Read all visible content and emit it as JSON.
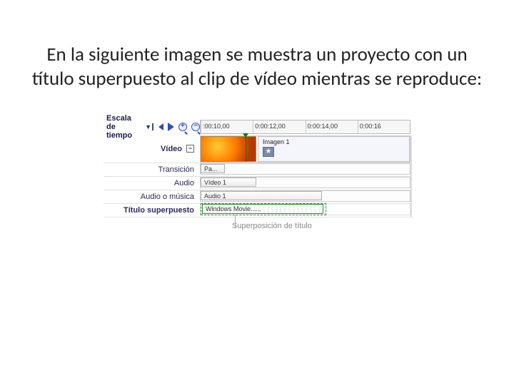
{
  "description_text": "En la siguiente imagen se muestra un proyecto con un título superpuesto al clip de vídeo mientras se reproduce:",
  "toolbar": {
    "scale_label": "Escala de tiempo"
  },
  "ruler": {
    "t0": ":00:10,00",
    "t1": "0:00:12,00",
    "t2": "0:00:14,00",
    "t3": "0:00:16"
  },
  "tracks": {
    "video_label": "Vídeo",
    "collapse_symbol": "−",
    "image_clip_name": "Imagen 1",
    "star_glyph": "★",
    "transition_label": "Transición",
    "transition_clip": "Pa...",
    "audio_label": "Audio",
    "audio_clip": "Vídeo 1",
    "music_label": "Audio o música",
    "music_clip": "Audio 1",
    "title_label": "Título superpuesto",
    "title_clip": "Windows Movie......"
  },
  "callout_text": "Superposición de título"
}
